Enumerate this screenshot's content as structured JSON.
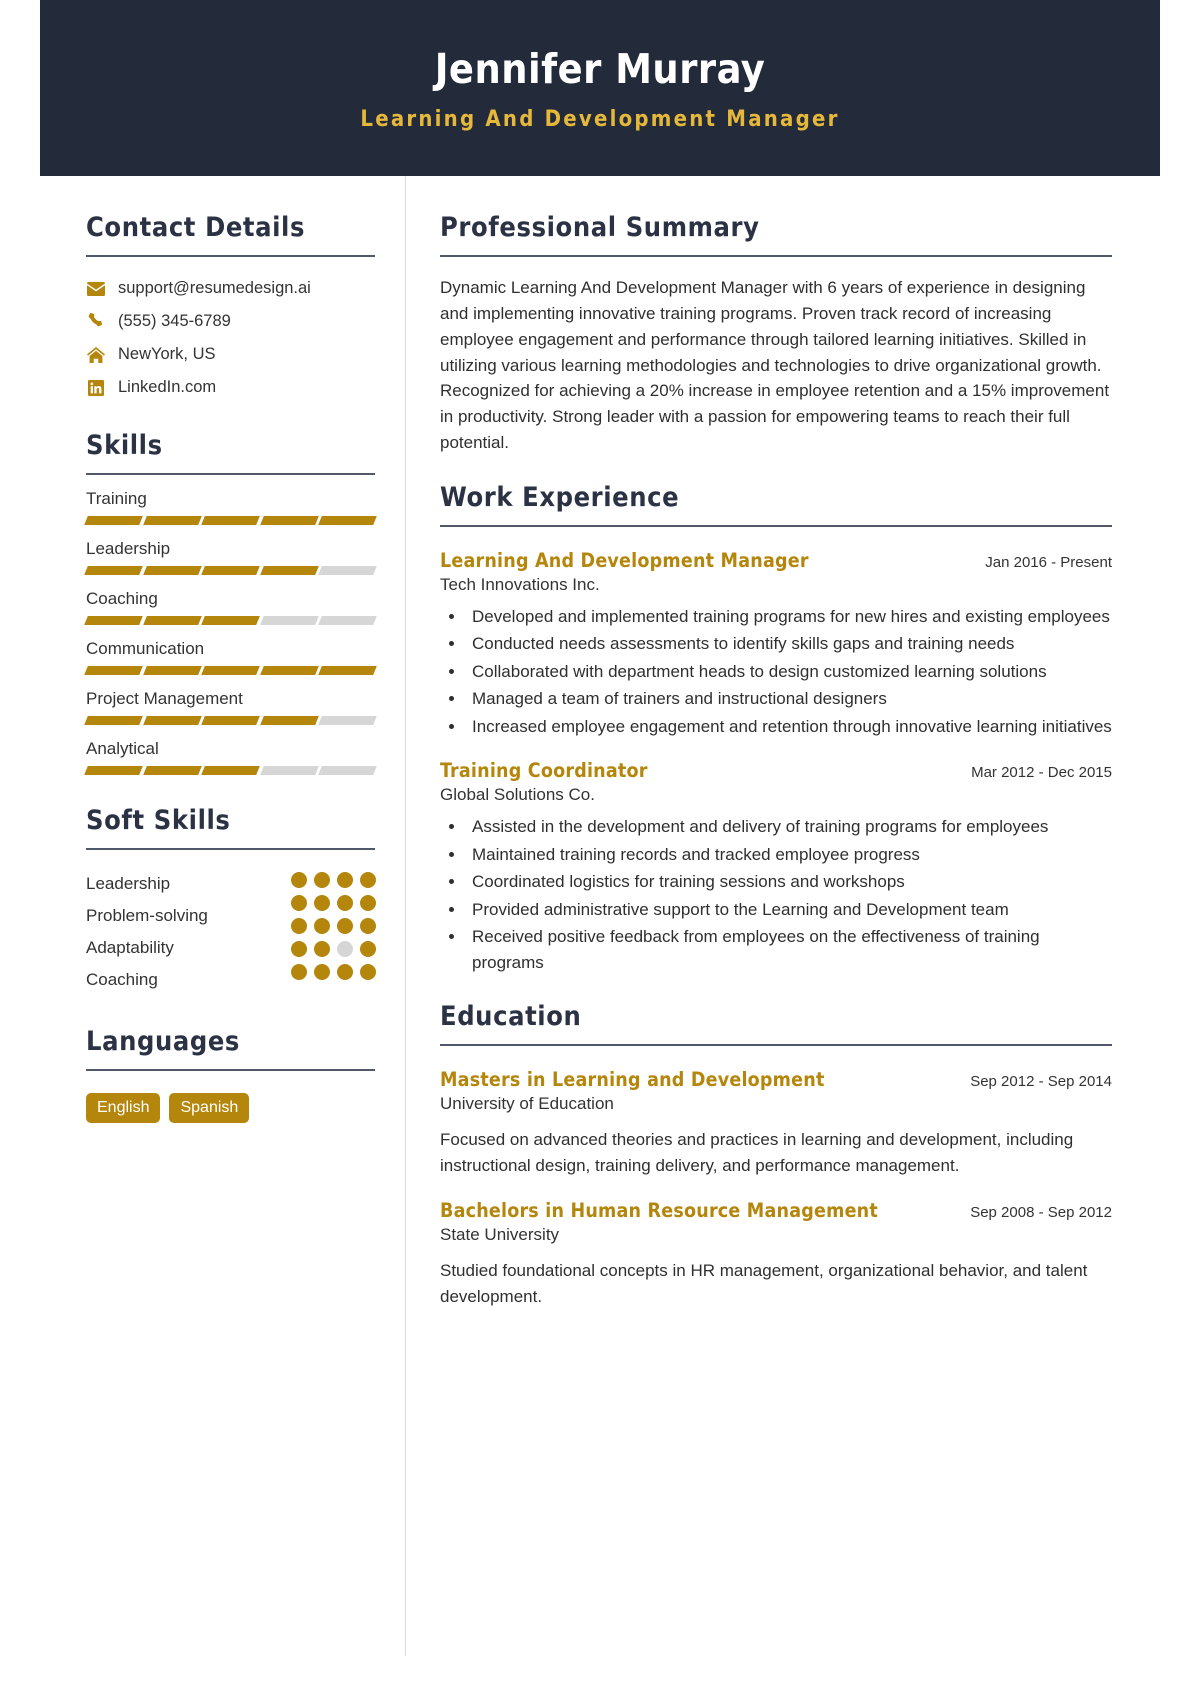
{
  "colors": {
    "header_bg": "#232b3b",
    "accent_gold": "#b4860c",
    "header_subtitle": "#e5b73b",
    "rule": "#50586b",
    "bar_empty": "#d6d6d6"
  },
  "header": {
    "name": "Jennifer Murray",
    "title": "Learning And Development Manager"
  },
  "sidebar": {
    "contact": {
      "heading": "Contact Details",
      "items": [
        {
          "icon": "envelope-icon",
          "value": "support@resumedesign.ai"
        },
        {
          "icon": "phone-icon",
          "value": "(555) 345-6789"
        },
        {
          "icon": "home-icon",
          "value": "NewYork, US"
        },
        {
          "icon": "linkedin-icon",
          "value": "LinkedIn.com"
        }
      ]
    },
    "skills": {
      "heading": "Skills",
      "max": 5,
      "items": [
        {
          "name": "Training",
          "level": 5
        },
        {
          "name": "Leadership",
          "level": 4
        },
        {
          "name": "Coaching",
          "level": 3
        },
        {
          "name": "Communication",
          "level": 5
        },
        {
          "name": "Project Management",
          "level": 4
        },
        {
          "name": "Analytical",
          "level": 3
        }
      ]
    },
    "soft_skills": {
      "heading": "Soft Skills",
      "max": 5,
      "items": [
        {
          "name": "Leadership",
          "level": 5
        },
        {
          "name": "Problem-solving",
          "level": 5
        },
        {
          "name": "Adaptability",
          "level": 4
        },
        {
          "name": "Coaching",
          "level": 5
        }
      ]
    },
    "languages": {
      "heading": "Languages",
      "items": [
        "English",
        "Spanish"
      ]
    }
  },
  "main": {
    "summary": {
      "heading": "Professional Summary",
      "text": "Dynamic Learning And Development Manager with 6 years of experience in designing and implementing innovative training programs. Proven track record of increasing employee engagement and performance through tailored learning initiatives. Skilled in utilizing various learning methodologies and technologies to drive organizational growth. Recognized for achieving a 20% increase in employee retention and a 15% improvement in productivity. Strong leader with a passion for empowering teams to reach their full potential."
    },
    "work": {
      "heading": "Work Experience",
      "entries": [
        {
          "title": "Learning And Development Manager",
          "date": "Jan 2016 - Present",
          "organization": "Tech Innovations Inc.",
          "bullets": [
            "Developed and implemented training programs for new hires and existing employees",
            "Conducted needs assessments to identify skills gaps and training needs",
            "Collaborated with department heads to design customized learning solutions",
            "Managed a team of trainers and instructional designers",
            "Increased employee engagement and retention through innovative learning initiatives"
          ]
        },
        {
          "title": "Training Coordinator",
          "date": "Mar 2012 - Dec 2015",
          "organization": "Global Solutions Co.",
          "bullets": [
            "Assisted in the development and delivery of training programs for employees",
            "Maintained training records and tracked employee progress",
            "Coordinated logistics for training sessions and workshops",
            "Provided administrative support to the Learning and Development team",
            "Received positive feedback from employees on the effectiveness of training programs"
          ]
        }
      ]
    },
    "education": {
      "heading": "Education",
      "entries": [
        {
          "title": "Masters in Learning and Development",
          "date": "Sep 2012 - Sep 2014",
          "organization": "University of Education",
          "description": "Focused on advanced theories and practices in learning and development, including instructional design, training delivery, and performance management."
        },
        {
          "title": "Bachelors in Human Resource Management",
          "date": "Sep 2008 - Sep 2012",
          "organization": "State University",
          "description": "Studied foundational concepts in HR management, organizational behavior, and talent development."
        }
      ]
    }
  }
}
